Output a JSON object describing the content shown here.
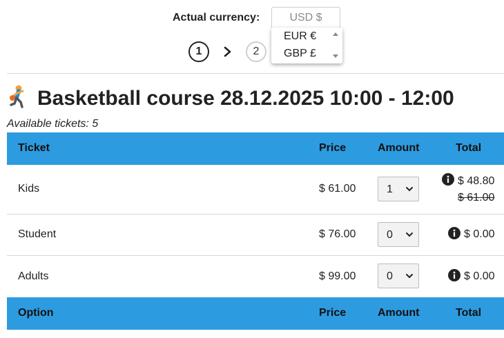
{
  "currency": {
    "label": "Actual currency:",
    "selected": "USD $",
    "options": [
      "EUR €",
      "GBP £"
    ]
  },
  "steps": [
    {
      "number": "1",
      "active": true
    },
    {
      "number": "2",
      "active": false
    }
  ],
  "event": {
    "title": "Basketball course 28.12.2025 10:00 - 12:00",
    "title_icon": "basketball-player-icon",
    "available": "Available tickets: 5"
  },
  "tickets_table": {
    "headers": {
      "ticket": "Ticket",
      "price": "Price",
      "amount": "Amount",
      "total": "Total"
    },
    "rows": [
      {
        "name": "Kids",
        "price": "$ 61.00",
        "amount": "1",
        "total": "$ 48.80",
        "original_total": "$ 61.00"
      },
      {
        "name": "Student",
        "price": "$ 76.00",
        "amount": "0",
        "total": "$ 0.00"
      },
      {
        "name": "Adults",
        "price": "$ 99.00",
        "amount": "0",
        "total": "$ 0.00"
      }
    ]
  },
  "options_table": {
    "headers": {
      "option": "Option",
      "price": "Price",
      "amount": "Amount",
      "total": "Total"
    }
  },
  "colors": {
    "header_bg": "#2d9be0",
    "divider": "#d7d7d7",
    "text": "#222222"
  }
}
